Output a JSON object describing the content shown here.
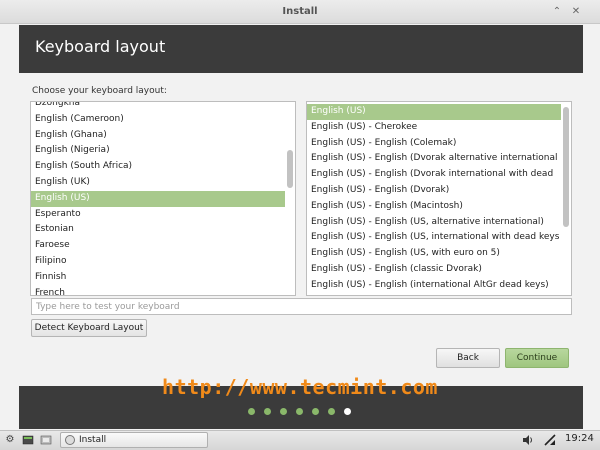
{
  "window": {
    "title": "Install",
    "minimize_glyph": "⌃",
    "close_glyph": "✕"
  },
  "header": {
    "heading": "Keyboard layout"
  },
  "prompt": "Choose your keyboard layout:",
  "layouts": {
    "items": [
      "Dzongkha",
      "English (Cameroon)",
      "English (Ghana)",
      "English (Nigeria)",
      "English (South Africa)",
      "English (UK)",
      "English (US)",
      "Esperanto",
      "Estonian",
      "Faroese",
      "Filipino",
      "Finnish",
      "French"
    ],
    "selected": "English (US)"
  },
  "variants": {
    "items": [
      "English (US)",
      "English (US) - Cherokee",
      "English (US) - English (Colemak)",
      "English (US) - English (Dvorak alternative international",
      "English (US) - English (Dvorak international with dead",
      "English (US) - English (Dvorak)",
      "English (US) - English (Macintosh)",
      "English (US) - English (US, alternative international)",
      "English (US) - English (US, international with dead keys",
      "English (US) - English (US, with euro on 5)",
      "English (US) - English (classic Dvorak)",
      "English (US) - English (international AltGr dead keys)"
    ],
    "selected": "English (US)"
  },
  "test_input": {
    "placeholder": "Type here to test your keyboard",
    "value": ""
  },
  "buttons": {
    "detect": "Detect Keyboard Layout",
    "back": "Back",
    "continue": "Continue"
  },
  "watermark": "http://www.tecmint.com",
  "progress": {
    "total_steps": 7,
    "current_step": 7
  },
  "colors": {
    "accent": "#a8c98c",
    "dark_panel": "#3b3b3b",
    "watermark": "#f08a1a"
  },
  "taskbar": {
    "task_label": "Install",
    "clock": "19:24",
    "icons": [
      "settings-icon",
      "terminal-icon",
      "files-icon",
      "volume-icon",
      "network-icon"
    ]
  }
}
